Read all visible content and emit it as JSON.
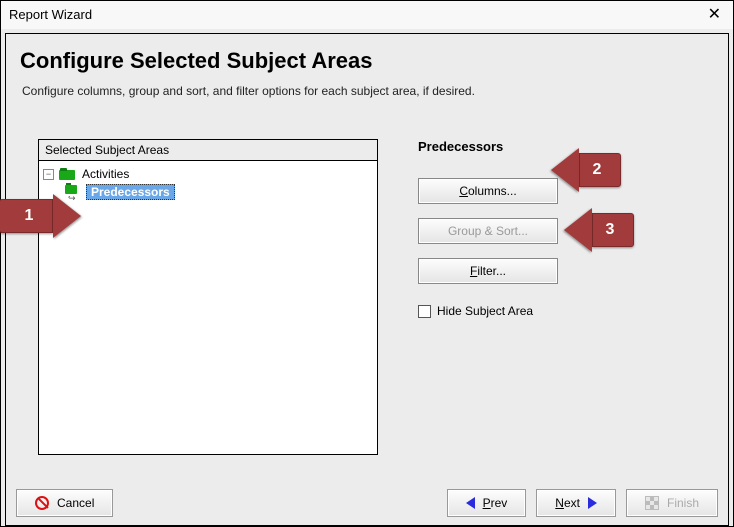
{
  "window": {
    "title": "Report Wizard"
  },
  "heading": "Configure Selected Subject Areas",
  "subtitle": "Configure columns, group and sort, and filter options for each subject area, if desired.",
  "tree": {
    "header": "Selected Subject Areas",
    "nodes": {
      "activities": "Activities",
      "predecessors": "Predecessors"
    }
  },
  "right": {
    "heading": "Predecessors",
    "buttons": {
      "columns": "Columns...",
      "group_sort": "Group & Sort...",
      "filter": "Filter..."
    },
    "hide_label": "Hide Subject Area"
  },
  "footer": {
    "cancel": "Cancel",
    "prev": "Prev",
    "next": "Next",
    "finish": "Finish"
  },
  "markers": {
    "m1": "1",
    "m2": "2",
    "m3": "3"
  }
}
